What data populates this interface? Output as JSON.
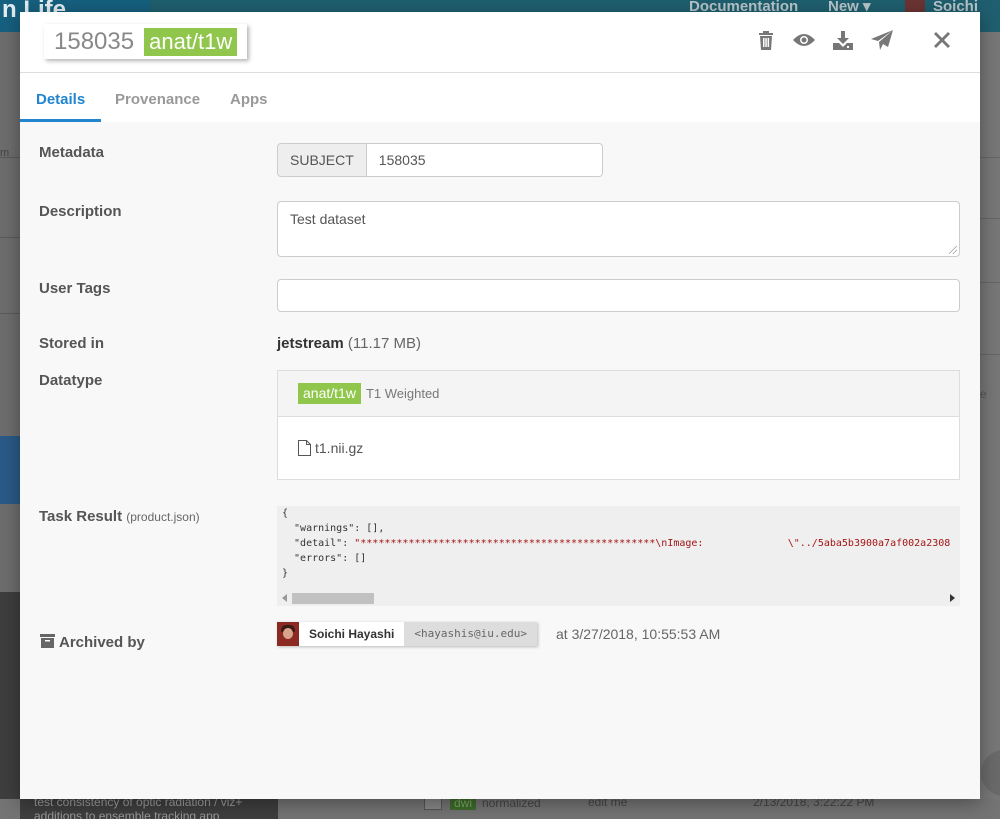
{
  "background": {
    "brand_partial": "n Life",
    "nav_links": [
      "Documentation",
      "New"
    ],
    "user_partial": "Soichi Ha",
    "left_partial_text": "m",
    "bottom_task_text": "test consistency of optic radiation / viz+",
    "bottom_task_text_2": "additions to ensemble tracking app",
    "bottom_tag": "dwi",
    "bottom_status": "normalized",
    "bottom_desc": "edit me",
    "bottom_time": "2/13/2018, 3:22:22 PM",
    "right_partial_text": "e"
  },
  "header": {
    "subject_id": "158035",
    "datatype_tag": "anat/t1w",
    "icons": [
      "trash-icon",
      "eye-icon",
      "download-icon",
      "send-icon",
      "close-icon"
    ]
  },
  "tabs": [
    {
      "label": "Details",
      "active": true
    },
    {
      "label": "Provenance",
      "active": false
    },
    {
      "label": "Apps",
      "active": false
    }
  ],
  "details": {
    "metadata_label": "Metadata",
    "metadata_key": "SUBJECT",
    "metadata_value": "158035",
    "description_label": "Description",
    "description_value": "Test dataset",
    "user_tags_label": "User Tags",
    "user_tags_value": "",
    "stored_label": "Stored in",
    "stored_location": "jetstream",
    "stored_size": "(11.17 MB)",
    "datatype_label": "Datatype",
    "datatype_tag": "anat/t1w",
    "datatype_desc": "T1 Weighted",
    "datatype_file": "t1.nii.gz",
    "task_result_label": "Task Result",
    "task_result_file": "(product.json)",
    "task_json": {
      "open": "{",
      "warnings_line": "  \"warnings\": [],",
      "detail_key": "  \"detail\": ",
      "detail_value": "\"*************************************************\\nImage:              \\\"../5aba5b3900a7af002a2308",
      "errors_line": "  \"errors\": []",
      "close": "}"
    },
    "archived_label": "Archived by",
    "archived_user": "Soichi Hayashi",
    "archived_email": "<hayashis@iu.edu>",
    "archived_time": "at 3/27/2018, 10:55:53 AM"
  },
  "colors": {
    "accent": "#2185d0",
    "tag_green": "#8fc64b"
  }
}
